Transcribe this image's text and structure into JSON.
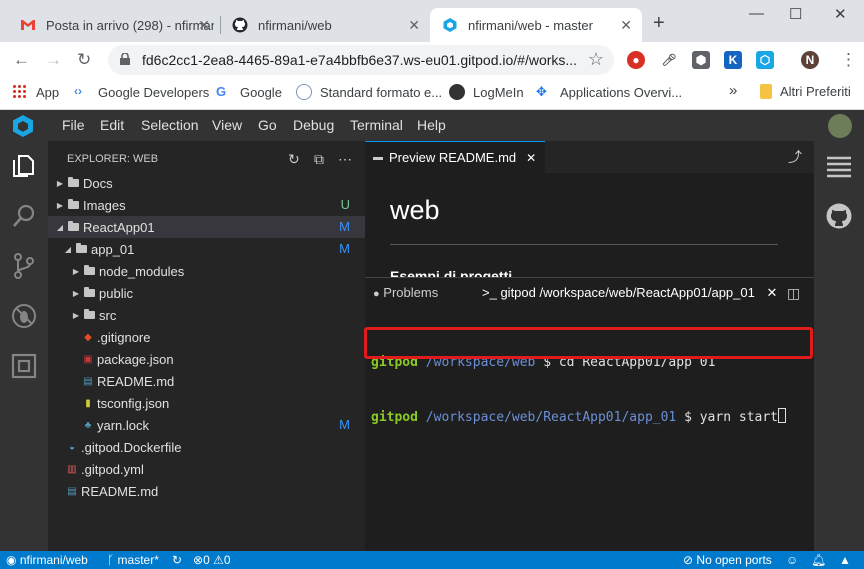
{
  "browser": {
    "tabs": [
      {
        "title": "Posta in arrivo (298) - nfirmani",
        "icon": "gmail-icon"
      },
      {
        "title": "nfirmani/web",
        "icon": "github-icon"
      },
      {
        "title": "nfirmani/web - master",
        "icon": "gitpod-icon",
        "active": true
      }
    ],
    "url": "fd6c2cc1-2ea8-4465-89a1-e7a4bbfb6e37.ws-eu01.gitpod.io/#/works...",
    "profile_initial": "N",
    "ext_k": "K",
    "bookmarks": [
      "App",
      "Google Developers",
      "Google",
      "Standard formato e...",
      "LogMeIn",
      "Applications Overvi..."
    ],
    "more": "»",
    "other_bookmarks": "Altri Preferiti"
  },
  "ide": {
    "menu": [
      "File",
      "Edit",
      "Selection",
      "View",
      "Go",
      "Debug",
      "Terminal",
      "Help"
    ],
    "explorer_title": "EXPLORER: WEB",
    "tree": [
      {
        "label": "Docs",
        "type": "folder",
        "depth": 0,
        "expanded": false,
        "badge": ""
      },
      {
        "label": "Images",
        "type": "folder",
        "depth": 0,
        "expanded": false,
        "badge": "U"
      },
      {
        "label": "ReactApp01",
        "type": "folder",
        "depth": 0,
        "expanded": true,
        "badge": "M",
        "selected": true
      },
      {
        "label": "app_01",
        "type": "folder",
        "depth": 1,
        "expanded": true,
        "badge": "M"
      },
      {
        "label": "node_modules",
        "type": "folder",
        "depth": 2,
        "expanded": false,
        "badge": ""
      },
      {
        "label": "public",
        "type": "folder",
        "depth": 2,
        "expanded": false,
        "badge": ""
      },
      {
        "label": "src",
        "type": "folder",
        "depth": 2,
        "expanded": false,
        "badge": ""
      },
      {
        "label": ".gitignore",
        "type": "file",
        "depth": 2,
        "icon": "git-file-icon",
        "badge": ""
      },
      {
        "label": "package.json",
        "type": "file",
        "depth": 2,
        "icon": "npm-file-icon",
        "badge": ""
      },
      {
        "label": "README.md",
        "type": "file",
        "depth": 2,
        "icon": "markdown-file-icon",
        "badge": ""
      },
      {
        "label": "tsconfig.json",
        "type": "file",
        "depth": 2,
        "icon": "json-file-icon",
        "badge": ""
      },
      {
        "label": "yarn.lock",
        "type": "file",
        "depth": 2,
        "icon": "yarn-file-icon",
        "badge": "M"
      },
      {
        "label": ".gitpod.Dockerfile",
        "type": "file",
        "depth": 0,
        "icon": "docker-file-icon",
        "badge": ""
      },
      {
        "label": ".gitpod.yml",
        "type": "file",
        "depth": 0,
        "icon": "yaml-file-icon",
        "badge": ""
      },
      {
        "label": "README.md",
        "type": "file",
        "depth": 0,
        "icon": "markdown-file-icon",
        "badge": ""
      }
    ],
    "editor_tab": "Preview README.md",
    "preview": {
      "heading": "web",
      "subheading": "Esempi di progetti"
    },
    "panel_tabs": {
      "problems": "Problems",
      "terminal": "gitpod /workspace/web/ReactApp01/app_01"
    },
    "terminal": [
      {
        "user": "gitpod",
        "path": "/workspace/web",
        "cmd": "$ cd ReactApp01/app 01"
      },
      {
        "user": "gitpod",
        "path": "/workspace/web/ReactApp01/app_01",
        "cmd": "$ yarn start"
      }
    ]
  },
  "status": {
    "repo": "nfirmani/web",
    "branch": "master*",
    "errors": "0",
    "warnings": "0",
    "ports": "No open ports"
  },
  "colors": {
    "accent": "#007acc",
    "highlight": "#e01b1b",
    "prompt_user": "#8ac926",
    "prompt_path": "#6b8fd6"
  }
}
